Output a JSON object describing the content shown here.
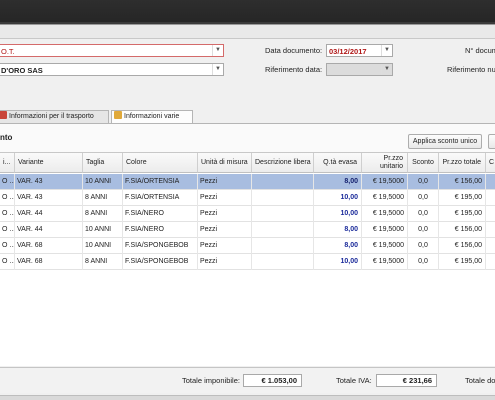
{
  "header": {
    "customer_code_value": "O.T.",
    "customer_name_value": "D'ORO SAS",
    "data_documento_label": "Data documento:",
    "data_documento_value": "03/12/2017",
    "n_documento_label": "N° docum",
    "riferimento_data_label": "Riferimento data:",
    "riferimento_data_value": "",
    "riferimento_numero_label": "Riferimento nu"
  },
  "tabs": [
    {
      "label": "Informazioni per il trasporto"
    },
    {
      "label": "Informazioni varie"
    }
  ],
  "grid": {
    "title": "nto",
    "apply_discount_label": "Applica sconto unico",
    "columns": {
      "first": "i...",
      "variante": "Variante",
      "taglia": "Taglia",
      "colore": "Colore",
      "unita": "Unità di misura",
      "descrizione": "Descrizione libera",
      "qta": "Q.tà evasa",
      "prezzo": "Pr.zzo unitario",
      "sconto": "Sconto",
      "totale": "Pr.zzo totale",
      "last": "C"
    },
    "rows": [
      {
        "first": "O ...",
        "variante": "VAR. 43",
        "taglia": "10 ANNI",
        "colore": "F.SIA/ORTENSIA",
        "unita": "Pezzi",
        "descrizione": "",
        "qta": "8,00",
        "prezzo": "€ 19,5000",
        "sconto": "0,0",
        "totale": "€ 156,00",
        "selected": true
      },
      {
        "first": "O ...",
        "variante": "VAR. 43",
        "taglia": "8 ANNI",
        "colore": "F.SIA/ORTENSIA",
        "unita": "Pezzi",
        "descrizione": "",
        "qta": "10,00",
        "prezzo": "€ 19,5000",
        "sconto": "0,0",
        "totale": "€ 195,00",
        "selected": false
      },
      {
        "first": "O ...",
        "variante": "VAR. 44",
        "taglia": "8 ANNI",
        "colore": "F.SIA/NERO",
        "unita": "Pezzi",
        "descrizione": "",
        "qta": "10,00",
        "prezzo": "€ 19,5000",
        "sconto": "0,0",
        "totale": "€ 195,00",
        "selected": false
      },
      {
        "first": "O ...",
        "variante": "VAR. 44",
        "taglia": "10 ANNI",
        "colore": "F.SIA/NERO",
        "unita": "Pezzi",
        "descrizione": "",
        "qta": "8,00",
        "prezzo": "€ 19,5000",
        "sconto": "0,0",
        "totale": "€ 156,00",
        "selected": false
      },
      {
        "first": "O ...",
        "variante": "VAR. 68",
        "taglia": "10 ANNI",
        "colore": "F.SIA/SPONGEBOB",
        "unita": "Pezzi",
        "descrizione": "",
        "qta": "8,00",
        "prezzo": "€ 19,5000",
        "sconto": "0,0",
        "totale": "€ 156,00",
        "selected": false
      },
      {
        "first": "O ...",
        "variante": "VAR. 68",
        "taglia": "8 ANNI",
        "colore": "F.SIA/SPONGEBOB",
        "unita": "Pezzi",
        "descrizione": "",
        "qta": "10,00",
        "prezzo": "€ 19,5000",
        "sconto": "0,0",
        "totale": "€ 195,00",
        "selected": false
      }
    ]
  },
  "totals": {
    "imponibile_label": "Totale imponibile:",
    "imponibile_value": "€ 1.053,00",
    "iva_label": "Totale IVA:",
    "iva_value": "€ 231,66",
    "documento_label": "Totale do"
  },
  "colors": {
    "selected_row": "#a8bde0",
    "quantity_text": "#1a2a9a",
    "date_text": "#b01818",
    "required_border": "#d46a6a"
  },
  "icons": {
    "transport_tab": "truck-icon",
    "misc_tab": "notes-icon"
  }
}
